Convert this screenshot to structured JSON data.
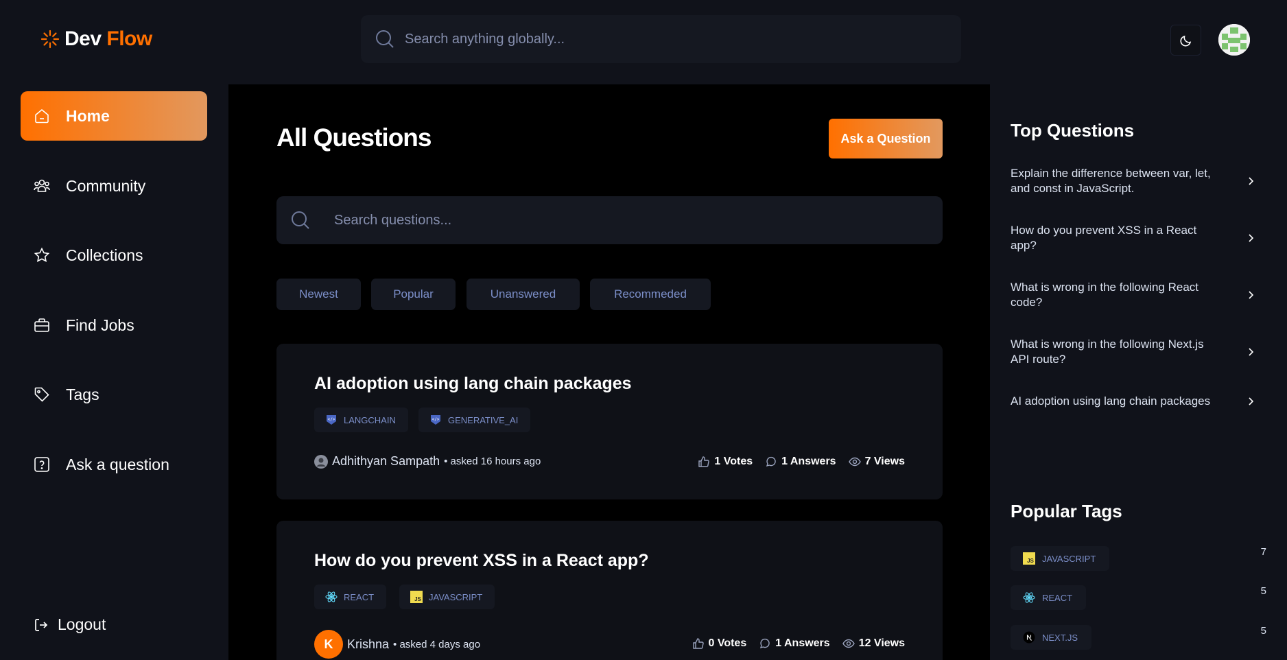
{
  "header": {
    "logo_word1": "Dev",
    "logo_word2": "Flow",
    "global_search_placeholder": "Search anything globally..."
  },
  "sidebar": {
    "items": [
      {
        "label": "Home",
        "icon": "home-icon",
        "active": true
      },
      {
        "label": "Community",
        "icon": "community-icon"
      },
      {
        "label": "Collections",
        "icon": "star-icon"
      },
      {
        "label": "Find Jobs",
        "icon": "briefcase-icon"
      },
      {
        "label": "Tags",
        "icon": "tag-icon"
      },
      {
        "label": "Ask a question",
        "icon": "question-icon"
      }
    ],
    "logout_label": "Logout"
  },
  "main": {
    "title": "All Questions",
    "ask_button": "Ask a Question",
    "search_placeholder": "Search questions...",
    "filters": [
      "Newest",
      "Popular",
      "Unanswered",
      "Recommeded"
    ],
    "questions": [
      {
        "title": "AI adoption using lang chain packages",
        "tags": [
          "LANGCHAIN",
          "GENERATIVE_AI"
        ],
        "author": "Adhithyan Sampath",
        "asked": "• asked 16 hours ago",
        "votes": "1 Votes",
        "answers": "1 Answers",
        "views": "7 Views"
      },
      {
        "title": "How do you prevent XSS in a React app?",
        "tags": [
          "REACT",
          "JAVASCRIPT"
        ],
        "author": "Krishna",
        "author_initial": "K",
        "asked": "• asked 4 days ago",
        "votes": "0 Votes",
        "answers": "1 Answers",
        "views": "12 Views"
      }
    ]
  },
  "right_sidebar": {
    "top_questions_heading": "Top Questions",
    "top_questions": [
      "Explain the difference between var, let, and const in JavaScript.",
      "How do you prevent XSS in a React app?",
      "What is wrong in the following React code?",
      "What is wrong in the following Next.js API route?",
      "AI adoption using lang chain packages"
    ],
    "popular_tags_heading": "Popular Tags",
    "popular_tags": [
      {
        "name": "JAVASCRIPT",
        "count": "7"
      },
      {
        "name": "REACT",
        "count": "5"
      },
      {
        "name": "NEXT.JS",
        "count": "5"
      }
    ]
  },
  "colors": {
    "accent": "#ff7000",
    "accent_light": "#e2985e",
    "tag_text": "#7b8ec8",
    "panel": "#10121a",
    "card": "#0f1117"
  }
}
